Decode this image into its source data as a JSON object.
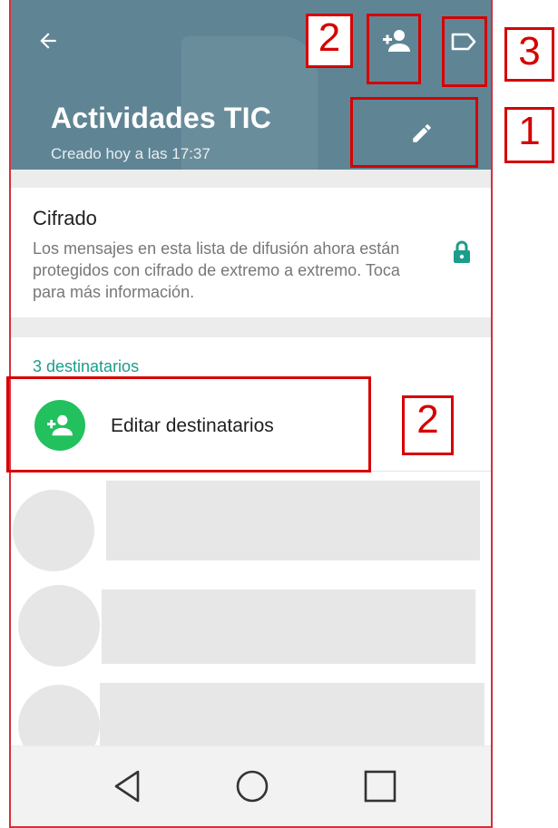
{
  "header": {
    "title": "Actividades TIC",
    "subtitle": "Creado hoy a las 17:37",
    "color": "#5f8595"
  },
  "icons": {
    "back": "arrow-left",
    "add_recipient": "person-add",
    "label": "label-tag",
    "edit": "pencil",
    "lock": "lock",
    "nav_back": "triangle-left",
    "nav_home": "circle",
    "nav_recents": "square"
  },
  "encryption": {
    "title": "Cifrado",
    "description": "Los mensajes en esta lista de difusión ahora están protegidos con cifrado de extremo a extremo. Toca para más información.",
    "lock_color": "#1c9d8a"
  },
  "recipients": {
    "count_label": "3 destinatarios",
    "edit_label": "Editar destinatarios",
    "accent_color": "#22c15e"
  },
  "annotations": {
    "box_right_of_edit_recipients": "2",
    "box_left_of_add_icon": "2",
    "box_right_of_label_icon": "3",
    "box_right_of_edit_icon": "1",
    "color": "#d60000"
  }
}
